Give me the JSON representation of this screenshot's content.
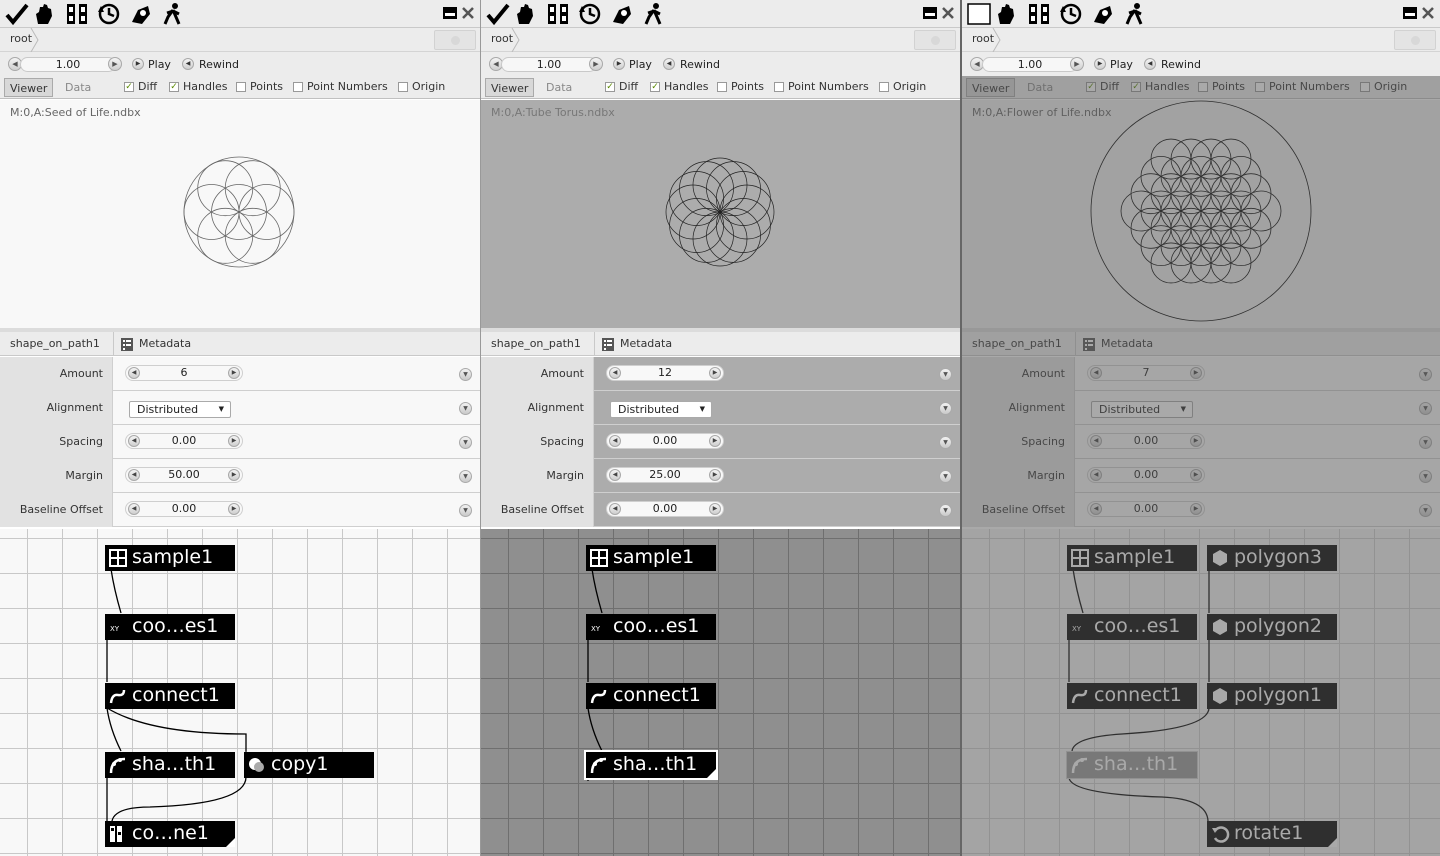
{
  "panels": [
    {
      "address": {
        "crumb": "root"
      },
      "frame": {
        "value": "1.00",
        "play": "Play",
        "rewind": "Rewind"
      },
      "tabs": {
        "viewer": "Viewer",
        "data": "Data"
      },
      "options": {
        "diff": "Diff",
        "handles": "Handles",
        "points": "Points",
        "point_numbers": "Point Numbers",
        "origin": "Origin"
      },
      "viewer_title": "M:0,A:Seed of Life.ndbx",
      "params_header": {
        "node": "shape_on_path1",
        "metadata": "Metadata"
      },
      "params": [
        {
          "label": "Amount",
          "value": "6"
        },
        {
          "label": "Alignment",
          "value": "Distributed"
        },
        {
          "label": "Spacing",
          "value": "0.00"
        },
        {
          "label": "Margin",
          "value": "50.00"
        },
        {
          "label": "Baseline Offset",
          "value": "0.00"
        }
      ],
      "nodes": [
        "sample1",
        "coo…es1",
        "connect1",
        "sha…th1",
        "copy1",
        "co…ne1"
      ]
    },
    {
      "address": {
        "crumb": "root"
      },
      "frame": {
        "value": "1.00",
        "play": "Play",
        "rewind": "Rewind"
      },
      "tabs": {
        "viewer": "Viewer",
        "data": "Data"
      },
      "options": {
        "diff": "Diff",
        "handles": "Handles",
        "points": "Points",
        "point_numbers": "Point Numbers",
        "origin": "Origin"
      },
      "viewer_title": "M:0,A:Tube Torus.ndbx",
      "params_header": {
        "node": "shape_on_path1",
        "metadata": "Metadata"
      },
      "params": [
        {
          "label": "Amount",
          "value": "12"
        },
        {
          "label": "Alignment",
          "value": "Distributed"
        },
        {
          "label": "Spacing",
          "value": "0.00"
        },
        {
          "label": "Margin",
          "value": "25.00"
        },
        {
          "label": "Baseline Offset",
          "value": "0.00"
        }
      ],
      "nodes": [
        "sample1",
        "coo…es1",
        "connect1",
        "sha…th1"
      ]
    },
    {
      "address": {
        "crumb": "root"
      },
      "frame": {
        "value": "1.00",
        "play": "Play",
        "rewind": "Rewind"
      },
      "tabs": {
        "viewer": "Viewer",
        "data": "Data"
      },
      "options": {
        "diff": "Diff",
        "handles": "Handles",
        "points": "Points",
        "point_numbers": "Point Numbers",
        "origin": "Origin"
      },
      "viewer_title": "M:0,A:Flower of Life.ndbx",
      "params_header": {
        "node": "shape_on_path1",
        "metadata": "Metadata"
      },
      "params": [
        {
          "label": "Amount",
          "value": "7"
        },
        {
          "label": "Alignment",
          "value": "Distributed"
        },
        {
          "label": "Spacing",
          "value": "0.00"
        },
        {
          "label": "Margin",
          "value": "0.00"
        },
        {
          "label": "Baseline Offset",
          "value": "0.00"
        }
      ],
      "nodes": [
        "sample1",
        "coo…es1",
        "connect1",
        "sha…th1",
        "polygon3",
        "polygon2",
        "polygon1",
        "rotate1"
      ]
    }
  ],
  "colors": {
    "viewer_bg": [
      "#f8f8f8",
      "#acacac",
      "#7f7f7f"
    ],
    "grid_bg": [
      "#f8f8f8",
      "#8f8f8f",
      "#7a7a7a"
    ],
    "check_color": "#6b9b00"
  }
}
